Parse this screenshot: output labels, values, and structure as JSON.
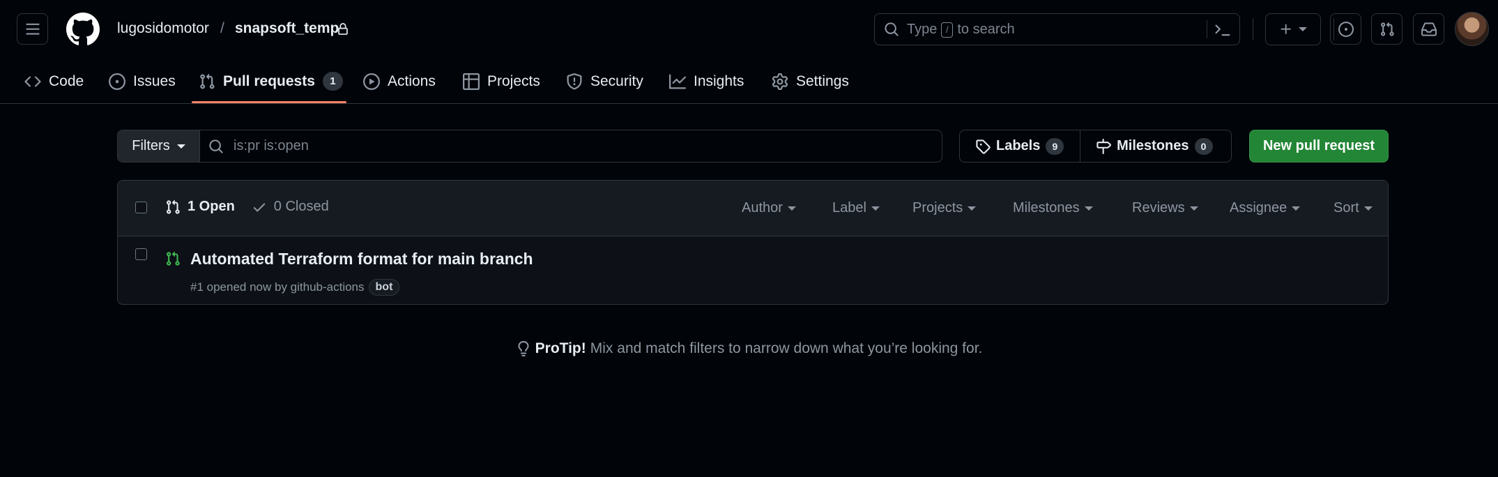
{
  "header": {
    "owner": "lugosidomotor",
    "separator": "/",
    "repo": "snapsoft_temp",
    "search": {
      "text_before": "Type",
      "key": "/",
      "text_after": "to search"
    }
  },
  "tabs": [
    {
      "label": "Code",
      "icon": "code-icon"
    },
    {
      "label": "Issues",
      "icon": "issue-opened-icon"
    },
    {
      "label": "Pull requests",
      "icon": "git-pull-request-icon",
      "count": "1",
      "active": true
    },
    {
      "label": "Actions",
      "icon": "play-icon"
    },
    {
      "label": "Projects",
      "icon": "table-icon"
    },
    {
      "label": "Security",
      "icon": "shield-icon"
    },
    {
      "label": "Insights",
      "icon": "graph-icon"
    },
    {
      "label": "Settings",
      "icon": "gear-icon"
    }
  ],
  "toolbar": {
    "filters_label": "Filters",
    "search_placeholder": "is:pr is:open",
    "labels_label": "Labels",
    "labels_count": "9",
    "milestones_label": "Milestones",
    "milestones_count": "0",
    "new_pr_label": "New pull request"
  },
  "list": {
    "open_label": "1 Open",
    "closed_label": "0 Closed",
    "menus": [
      "Author",
      "Label",
      "Projects",
      "Milestones",
      "Reviews",
      "Assignee",
      "Sort"
    ],
    "items": [
      {
        "title": "Automated Terraform format for main branch",
        "meta": "#1 opened now by github-actions",
        "label": "bot"
      }
    ]
  },
  "protip": {
    "bold": "ProTip!",
    "text": "Mix and match filters to narrow down what you’re looking for."
  },
  "colors": {
    "background": "#010409",
    "accent_underline": "#f78166",
    "primary_button": "#238636",
    "open_pr": "#3fb950"
  }
}
